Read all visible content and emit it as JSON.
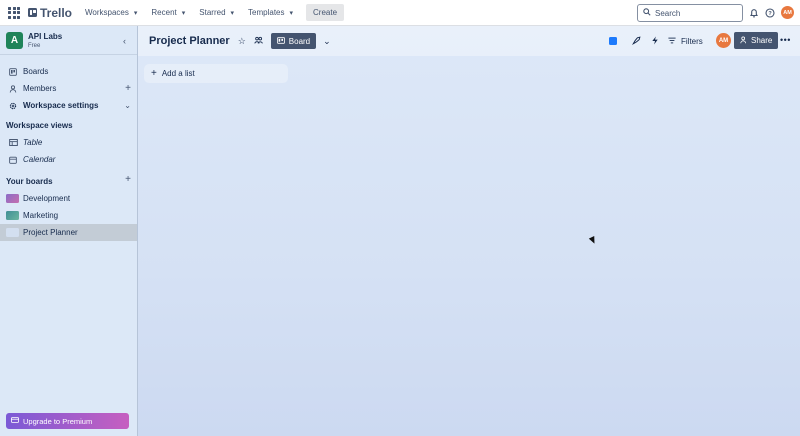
{
  "topbar": {
    "brand": "Trello",
    "nav": [
      {
        "label": "Workspaces"
      },
      {
        "label": "Recent"
      },
      {
        "label": "Starred"
      },
      {
        "label": "Templates"
      }
    ],
    "create_label": "Create",
    "search_placeholder": "Search",
    "user_initials": "AM"
  },
  "sidebar": {
    "workspace_initial": "A",
    "workspace_name": "API Labs",
    "workspace_plan": "Free",
    "items": [
      {
        "label": "Boards"
      },
      {
        "label": "Members"
      },
      {
        "label": "Workspace settings"
      }
    ],
    "views_heading": "Workspace views",
    "views": [
      {
        "label": "Table"
      },
      {
        "label": "Calendar"
      }
    ],
    "boards_heading": "Your boards",
    "boards": [
      {
        "label": "Development",
        "color": "#8a6cc7"
      },
      {
        "label": "Marketing",
        "color": "#4a9e9f"
      },
      {
        "label": "Project Planner",
        "color": "#d3dff0"
      }
    ],
    "upgrade_label": "Upgrade to Premium"
  },
  "board": {
    "title": "Project Planner",
    "view_label": "Board",
    "filters_label": "Filters",
    "member_initials": "AM",
    "share_label": "Share",
    "add_list_label": "Add a list"
  },
  "colors": {
    "accent": "#1f845a",
    "avatar": "#e8783f",
    "dark_button": "#44546f"
  }
}
